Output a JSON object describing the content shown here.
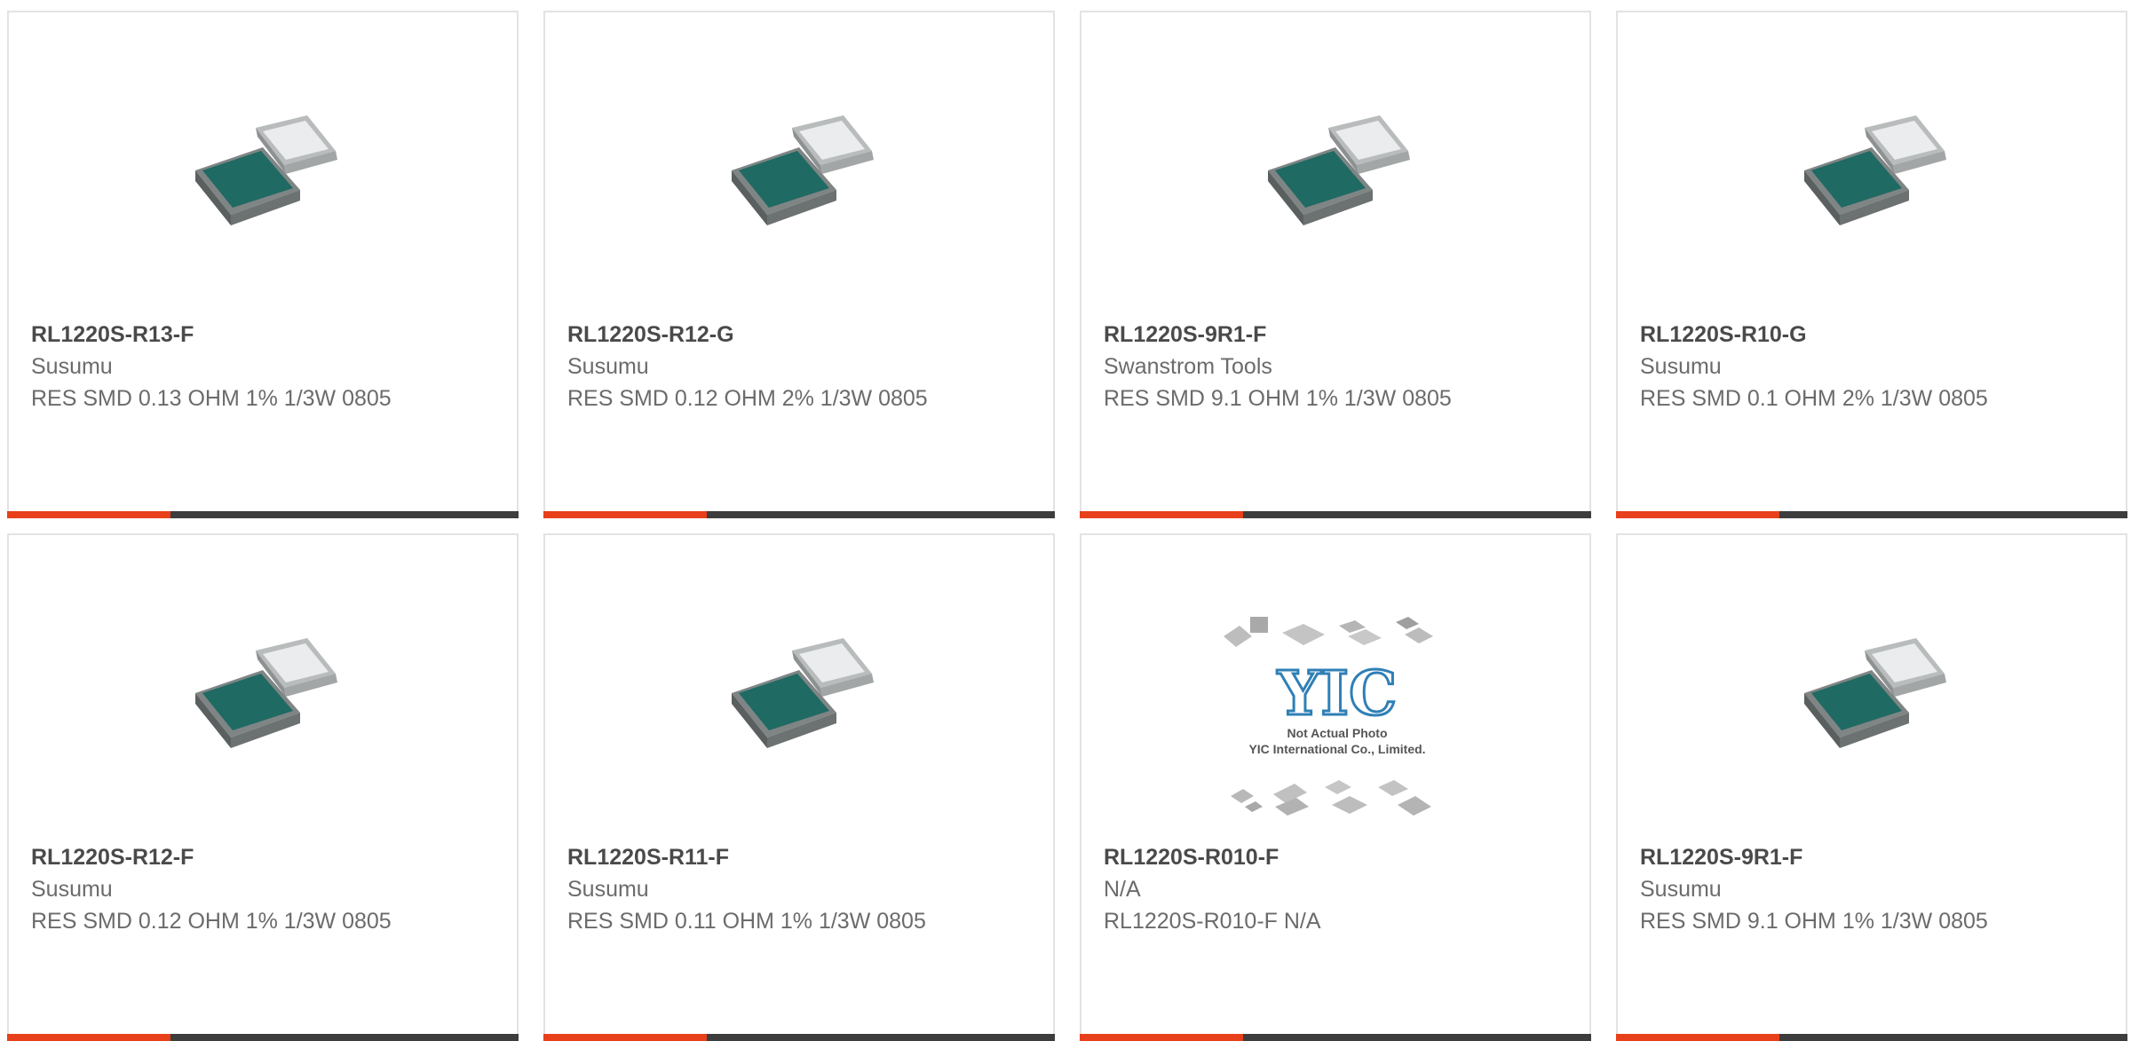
{
  "colors": {
    "accent": "#e8401a",
    "bar": "#3d3d3d",
    "chip_teal": "#1f6a63"
  },
  "products": [
    {
      "part_number": "RL1220S-R13-F",
      "manufacturer": "Susumu",
      "description": "RES SMD 0.13 OHM 1% 1/3W 0805",
      "image": "resistor-chip-image"
    },
    {
      "part_number": "RL1220S-R12-G",
      "manufacturer": "Susumu",
      "description": "RES SMD 0.12 OHM 2% 1/3W 0805",
      "image": "resistor-chip-image"
    },
    {
      "part_number": "RL1220S-9R1-F",
      "manufacturer": "Swanstrom Tools",
      "description": "RES SMD 9.1 OHM 1% 1/3W 0805",
      "image": "resistor-chip-image"
    },
    {
      "part_number": "RL1220S-R10-G",
      "manufacturer": "Susumu",
      "description": "RES SMD 0.1 OHM 2% 1/3W 0805",
      "image": "resistor-chip-image"
    },
    {
      "part_number": "RL1220S-R12-F",
      "manufacturer": "Susumu",
      "description": "RES SMD 0.12 OHM 1% 1/3W 0805",
      "image": "resistor-chip-image"
    },
    {
      "part_number": "RL1220S-R11-F",
      "manufacturer": "Susumu",
      "description": "RES SMD 0.11 OHM 1% 1/3W 0805",
      "image": "resistor-chip-image"
    },
    {
      "part_number": "RL1220S-R010-F",
      "manufacturer": "N/A",
      "description": "RL1220S-R010-F N/A",
      "image": "placeholder-image",
      "placeholder": {
        "logo": "YIC",
        "line1": "Not Actual Photo",
        "line2": "YIC International Co., Limited."
      }
    },
    {
      "part_number": "RL1220S-9R1-F",
      "manufacturer": "Susumu",
      "description": "RES SMD 9.1 OHM 1% 1/3W 0805",
      "image": "resistor-chip-image"
    }
  ]
}
